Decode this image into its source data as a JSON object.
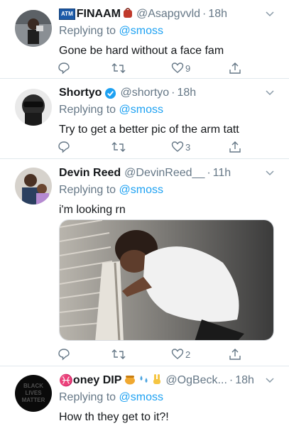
{
  "tweets": [
    {
      "badge": "ATM",
      "name": "FINAAM",
      "handle": "@Asapgvvld",
      "time": "18h",
      "reply_prefix": "Replying to",
      "reply_to": "@smoss",
      "text": "Gone be hard without a face fam",
      "likes": "9",
      "avatar_icon": "person-avatar-icon"
    },
    {
      "name": "Shortyo",
      "handle": "@shortyo",
      "time": "18h",
      "reply_prefix": "Replying to",
      "reply_to": "@smoss",
      "text": "Try to get a better pic of the arm tatt",
      "likes": "3",
      "verified": true
    },
    {
      "name": "Devin Reed",
      "handle": "@DevinReed__",
      "time": "11h",
      "reply_prefix": "Replying to",
      "reply_to": "@smoss",
      "text": "i'm looking rn",
      "likes": "2",
      "has_media": true
    },
    {
      "name_symbol": "♓",
      "name": "oney DIP",
      "handle": "@OgBeck...",
      "time": "18h",
      "reply_prefix": "Replying to",
      "reply_to": "@smoss",
      "text": "How th they get to it?!",
      "avatar_text": "BLACK LIVES MATTER"
    }
  ],
  "colors": {
    "link": "#1da1f2",
    "muted": "#657786",
    "divider": "#e1e8ed",
    "verified": "#1da1f2"
  }
}
